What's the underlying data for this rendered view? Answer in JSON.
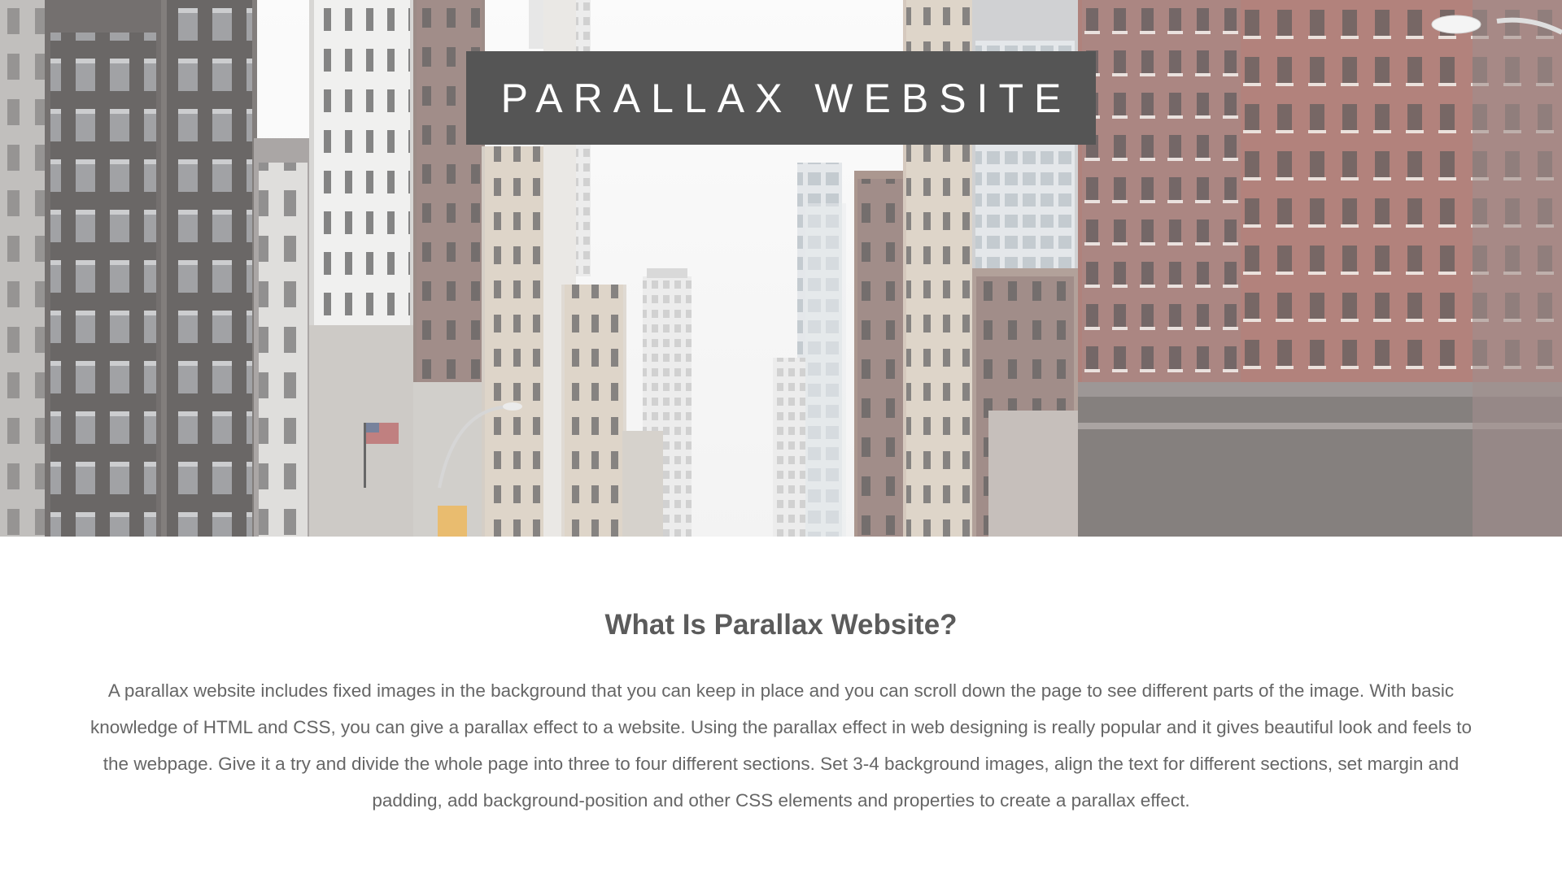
{
  "hero": {
    "title": "PARALLAX WEBSITE",
    "background_image": "city-street-photo"
  },
  "section": {
    "heading": "What Is Parallax Website?",
    "body": "A parallax website includes fixed images in the background that you can keep in place and you can scroll down the page to see different parts of the image. With basic knowledge of HTML and CSS, you can give a parallax effect to a website. Using the parallax effect in web designing is really popular and it gives beautiful look and feels to the webpage. Give it a try and divide the whole page into three to four different sections. Set 3-4 background images, align the text for different sections, set margin and padding, add background-position and other CSS elements and properties to create a parallax effect."
  },
  "colors": {
    "caption_bg": "#555555",
    "caption_text": "#ffffff",
    "heading": "#5b5b5b",
    "body_text": "#666666",
    "page_bg": "#ffffff"
  }
}
